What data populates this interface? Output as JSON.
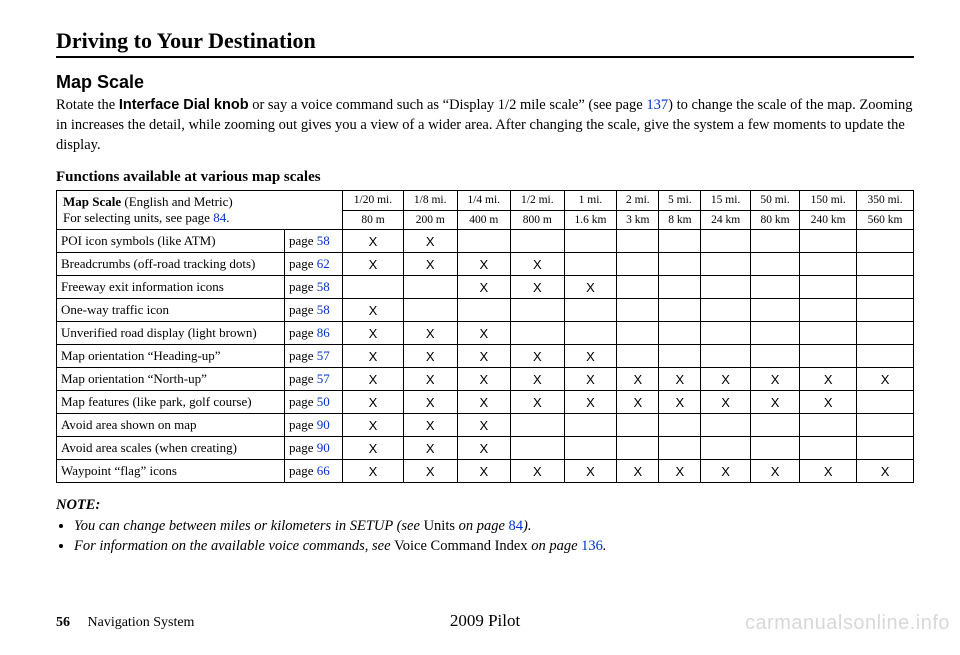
{
  "chapter": "Driving to Your Destination",
  "section": "Map Scale",
  "intro_parts": {
    "a": "Rotate the ",
    "b_bold": "Interface Dial knob",
    "c": " or say a voice command such as “Display 1/2 mile scale” (see page ",
    "link1": "137",
    "d": ") to change the scale of the map. Zooming in increases the detail, while zooming out gives you a view of a wider area. After changing the scale, give the system a few moments to update the display."
  },
  "table_caption": "Functions available at various map scales",
  "header": {
    "left_line1": "Map Scale",
    "left_line1_extra": " (English and Metric)",
    "left_line2a": "For selecting units, see page ",
    "left_line2_link": "84",
    "left_line2b": ".",
    "imperial": [
      "1/20 mi.",
      "1/8 mi.",
      "1/4 mi.",
      "1/2 mi.",
      "1 mi.",
      "2 mi.",
      "5 mi.",
      "15 mi.",
      "50 mi.",
      "150 mi.",
      "350 mi."
    ],
    "metric": [
      "80 m",
      "200 m",
      "400 m",
      "800 m",
      "1.6 km",
      "3 km",
      "8 km",
      "24 km",
      "80 km",
      "240 km",
      "560 km"
    ]
  },
  "rows": [
    {
      "label": "POI icon symbols (like ATM)",
      "page": "58",
      "x": [
        1,
        1,
        0,
        0,
        0,
        0,
        0,
        0,
        0,
        0,
        0
      ]
    },
    {
      "label": "Breadcrumbs (off-road tracking dots)",
      "page": "62",
      "x": [
        1,
        1,
        1,
        1,
        0,
        0,
        0,
        0,
        0,
        0,
        0
      ]
    },
    {
      "label": "Freeway exit information icons",
      "page": "58",
      "x": [
        0,
        0,
        1,
        1,
        1,
        0,
        0,
        0,
        0,
        0,
        0
      ]
    },
    {
      "label": "One-way traffic icon",
      "page": "58",
      "x": [
        1,
        0,
        0,
        0,
        0,
        0,
        0,
        0,
        0,
        0,
        0
      ]
    },
    {
      "label": "Unverified road display (light brown)",
      "page": "86",
      "x": [
        1,
        1,
        1,
        0,
        0,
        0,
        0,
        0,
        0,
        0,
        0
      ]
    },
    {
      "label": "Map orientation “Heading-up”",
      "page": "57",
      "x": [
        1,
        1,
        1,
        1,
        1,
        0,
        0,
        0,
        0,
        0,
        0
      ]
    },
    {
      "label": "Map orientation “North-up”",
      "page": "57",
      "x": [
        1,
        1,
        1,
        1,
        1,
        1,
        1,
        1,
        1,
        1,
        1
      ]
    },
    {
      "label": "Map features (like park, golf course)",
      "page": "50",
      "x": [
        1,
        1,
        1,
        1,
        1,
        1,
        1,
        1,
        1,
        1,
        0
      ]
    },
    {
      "label": "Avoid area shown on map",
      "page": "90",
      "x": [
        1,
        1,
        1,
        0,
        0,
        0,
        0,
        0,
        0,
        0,
        0
      ]
    },
    {
      "label": "Avoid area scales (when creating)",
      "page": "90",
      "x": [
        1,
        1,
        1,
        0,
        0,
        0,
        0,
        0,
        0,
        0,
        0
      ]
    },
    {
      "label": "Waypoint “flag” icons",
      "page": "66",
      "x": [
        1,
        1,
        1,
        1,
        1,
        1,
        1,
        1,
        1,
        1,
        1
      ]
    }
  ],
  "notes": {
    "head": "NOTE:",
    "items": [
      {
        "a": "You can change between miles or kilometers in SETUP (see ",
        "up": "Units",
        "b": " on page ",
        "link": "84",
        "c": ")."
      },
      {
        "a": "For information on the available voice commands, see ",
        "up": "Voice Command Index",
        "b": " on page ",
        "link": "136",
        "c": "."
      }
    ]
  },
  "footer": {
    "page_num": "56",
    "system": "Navigation System",
    "model": "2009  Pilot"
  },
  "watermark": "carmanualsonline.info"
}
